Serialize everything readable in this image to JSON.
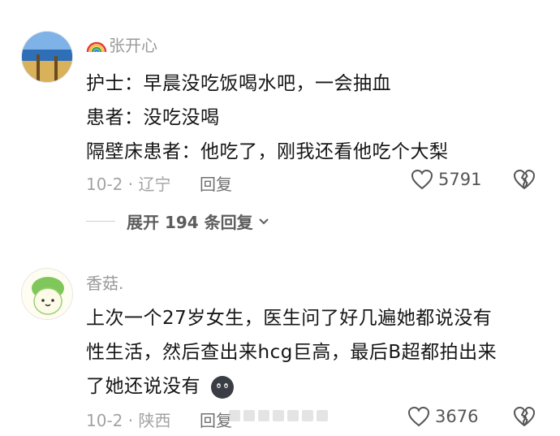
{
  "comments": [
    {
      "user": "张开心",
      "user_emoji": "rainbow-icon",
      "lines": [
        "护士：早晨没吃饭喝水吧，一会抽血",
        "患者：没吃没喝",
        "隔壁床患者：他吃了，刚我还看他吃个大梨"
      ],
      "meta": "10-2 · 辽宁",
      "reply_label": "回复",
      "likes": "5791",
      "expand_label": "展开 194 条回复"
    },
    {
      "user": "香菇.",
      "lines": [
        "上次一个27岁女生，医生问了好几遍她都说没有",
        "性生活，然后查出来hcg巨高，最后B超都拍出来",
        "了她还说没有"
      ],
      "meta": "10-2 · 陕西",
      "reply_label": "回复",
      "likes": "3676"
    }
  ],
  "colors": {
    "username": "#9a9a9a",
    "meta": "#a3a3a3",
    "text": "#161616"
  }
}
